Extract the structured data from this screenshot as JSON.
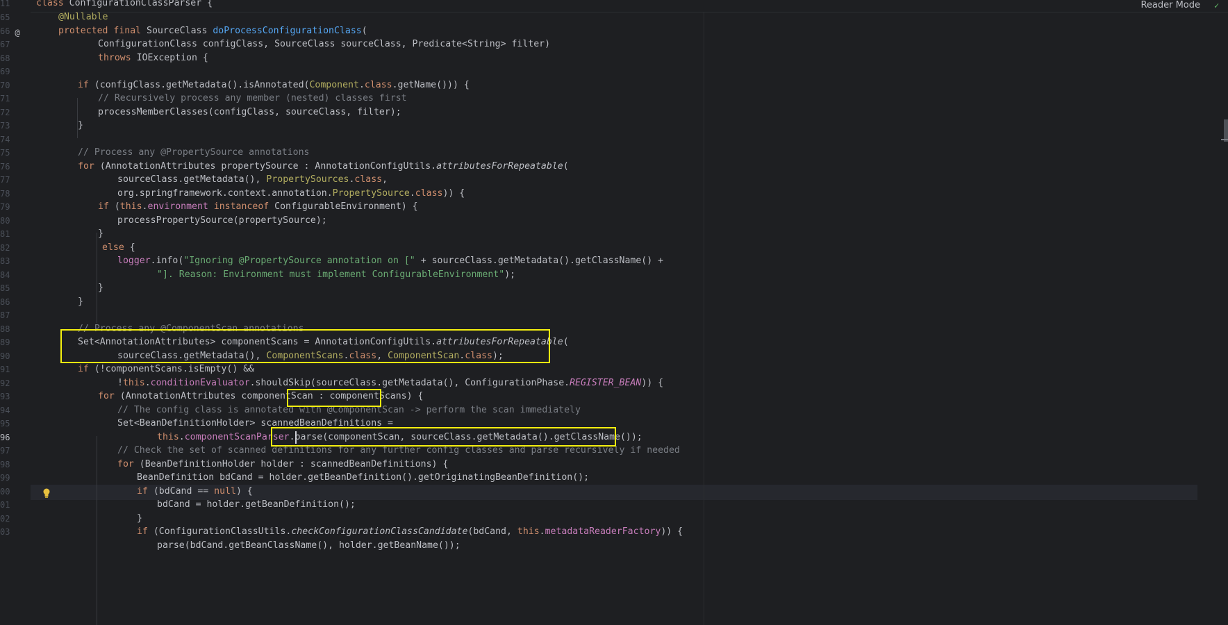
{
  "header": {
    "class_decl": "class ConfigurationClassParser {",
    "reader_mode": "Reader Mode",
    "status_icon": "check-icon"
  },
  "gutter": {
    "numbers": [
      "11",
      "65",
      "66",
      "67",
      "68",
      "69",
      "70",
      "71",
      "72",
      "73",
      "74",
      "75",
      "76",
      "77",
      "78",
      "79",
      "80",
      "81",
      "82",
      "83",
      "84",
      "85",
      "86",
      "87",
      "88",
      "89",
      "90",
      "91",
      "92",
      "93",
      "94",
      "95",
      "96",
      "97",
      "98",
      "99",
      "00",
      "01",
      "02",
      "03"
    ],
    "override_icon": "@",
    "bulb_icon": "lightbulb-icon"
  },
  "code": {
    "l66_ann": "@Nullable",
    "l66_mod": "protected final ",
    "l66_type": "SourceClass ",
    "l66_fn": "doProcessConfigurationClass",
    "l66_tail": "(",
    "l67": "ConfigurationClass configClass, SourceClass sourceClass, Predicate<String> filter)",
    "l68_kw": "throws ",
    "l68_tail": "IOException {",
    "l70_kw": "if ",
    "l70_a": "(configClass.getMetadata().isAnnotated(",
    "l70_cls": "Component",
    "l70_b": ".",
    "l70_kw2": "class",
    "l70_c": ".getName())) {",
    "l71": "// Recursively process any member (nested) classes first",
    "l72": "processMemberClasses(configClass, sourceClass, filter);",
    "l73": "}",
    "l75": "// Process any @PropertySource annotations",
    "l76_kw": "for ",
    "l76_a": "(AnnotationAttributes propertySource : AnnotationConfigUtils.",
    "l76_it": "attributesForRepeatable",
    "l76_b": "(",
    "l77_a": "sourceClass.getMetadata(), ",
    "l77_cls": "PropertySources",
    "l77_b": ".",
    "l77_kw": "class",
    "l77_c": ",",
    "l78_a": "org.springframework.context.annotation.",
    "l78_cls": "PropertySource",
    "l78_b": ".",
    "l78_kw": "class",
    "l78_c": ")) {",
    "l79_kw": "if ",
    "l79_a": "(",
    "l79_kw2": "this",
    "l79_b": ".",
    "l79_fld": "environment",
    "l79_c": " ",
    "l79_kw3": "instanceof",
    "l79_d": " ConfigurableEnvironment) {",
    "l80": "processPropertySource(propertySource);",
    "l81": "}",
    "l82_kw": "else",
    "l82_tail": " {",
    "l83_fld": "logger",
    "l83_a": ".info(",
    "l83_str": "\"Ignoring @PropertySource annotation on [\"",
    "l83_b": " + sourceClass.getMetadata().getClassName() +",
    "l84_str": "\"]. Reason: Environment must implement ConfigurableEnvironment\"",
    "l84_b": ");",
    "l85": "}",
    "l86": "}",
    "l88": "// Process any @ComponentScan annotations",
    "l89_a": "Set<AnnotationAttributes> componentScans = AnnotationConfigUtils.",
    "l89_it": "attributesForRepeatable",
    "l89_b": "(",
    "l90_a": "sourceClass.getMetadata(), ",
    "l90_cls1": "ComponentScans",
    "l90_b": ".",
    "l90_kw1": "class",
    "l90_c": ", ",
    "l90_cls2": "ComponentScan",
    "l90_d": ".",
    "l90_kw2": "class",
    "l90_e": ");",
    "l91_kw": "if ",
    "l91_a": "(!componentScans.isEmpty() &&",
    "l92_a": "!",
    "l92_kw": "this",
    "l92_b": ".",
    "l92_fld": "conditionEvaluator",
    "l92_c": ".shouldSkip(sourceClass.getMetadata(), ConfigurationPhase.",
    "l92_stat": "REGISTER_BEAN",
    "l92_d": ")) {",
    "l93_kw": "for ",
    "l93_a": "(AnnotationAttributes componentScan : componentScans) {",
    "l94": "// The config class is annotated with @ComponentScan -> perform the scan immediately",
    "l95": "Set<BeanDefinitionHolder> scannedBeanDefinitions =",
    "l96_kw": "this",
    "l96_a": ".",
    "l96_fld": "componentScanParser",
    "l96_b": ".parse(componentScan, sourceClass.getMetadata().getClassName());",
    "l97": "// Check the set of scanned definitions for any further config classes and parse recursively if needed",
    "l98_kw": "for ",
    "l98_a": "(BeanDefinitionHolder holder : scannedBeanDefinitions) {",
    "l99": "BeanDefinition bdCand = holder.getBeanDefinition().getOriginatingBeanDefinition();",
    "l00_kw": "if ",
    "l00_a": "(bdCand == ",
    "l00_kw2": "null",
    "l00_b": ") {",
    "l01": "bdCand = holder.getBeanDefinition();",
    "l02": "}",
    "l03_kw": "if ",
    "l03_a": "(ConfigurationClassUtils.",
    "l03_it": "checkConfigurationClassCandidate",
    "l03_b": "(bdCand, ",
    "l03_kw2": "this",
    "l03_c": ".",
    "l03_fld": "metadataReaderFactory",
    "l03_d": ")) {",
    "l04": "parse(bdCand.getBeanClassName(), holder.getBeanName());"
  },
  "colors": {
    "background": "#1e1f22",
    "highlight_box": "#f5f00f",
    "keyword": "#cf8e6d",
    "annotation": "#b3ae60",
    "function": "#56a8f5",
    "comment": "#7a7e85",
    "string": "#6aab73",
    "field": "#c77dbb"
  }
}
